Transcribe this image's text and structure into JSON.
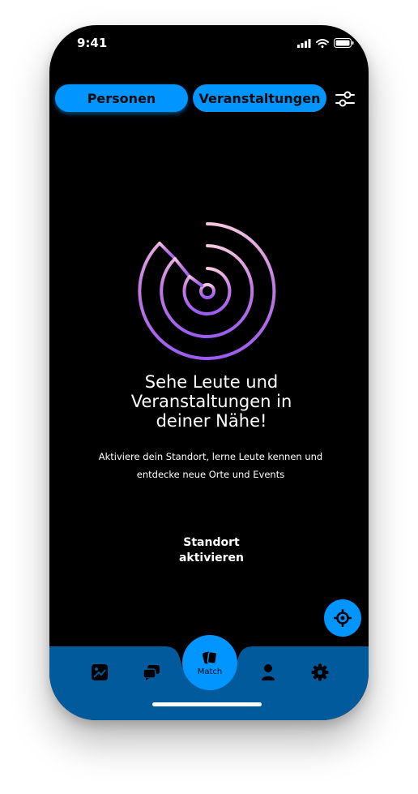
{
  "status_bar": {
    "time": "9:41"
  },
  "tabs": {
    "personen": "Personen",
    "veranstaltungen": "Veranstaltungen"
  },
  "main": {
    "headline_lines": [
      "Sehe Leute und",
      "Veranstaltungen in",
      "deiner Nähe!"
    ],
    "subtext_lines": [
      "Aktiviere dein Standort, lerne Leute kennen und",
      "entdecke neue Orte und Events"
    ],
    "cta_lines": [
      "Standort",
      "aktivieren"
    ]
  },
  "nav": {
    "match_label": "Match"
  },
  "colors": {
    "accent": "#0095ff",
    "tab_bar": "#005a9c",
    "radar_top": "#f4c6e0",
    "radar_bottom": "#9b5cf0"
  },
  "icons": [
    "signal-icon",
    "wifi-icon",
    "battery-icon",
    "filter-icon",
    "radar-icon",
    "location-target-icon",
    "map-icon",
    "chat-icon",
    "match-cards-icon",
    "profile-icon",
    "settings-icon"
  ]
}
